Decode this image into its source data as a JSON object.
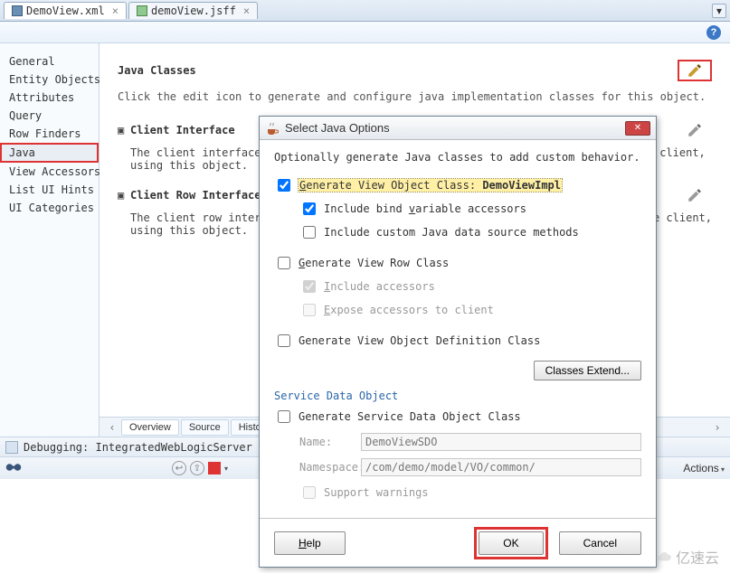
{
  "tabs": [
    {
      "label": "DemoView.xml"
    },
    {
      "label": "demoView.jsff"
    }
  ],
  "sidebar": {
    "items": [
      {
        "label": "General"
      },
      {
        "label": "Entity Objects"
      },
      {
        "label": "Attributes"
      },
      {
        "label": "Query"
      },
      {
        "label": "Row Finders"
      },
      {
        "label": "Java"
      },
      {
        "label": "View Accessors"
      },
      {
        "label": "List UI Hints"
      },
      {
        "label": "UI Categories"
      }
    ]
  },
  "main": {
    "heading": "Java Classes",
    "hint": "Click the edit icon to generate and configure java implementation classes for this object.",
    "sec1_title": "Client Interface",
    "sec1_text": "The client interface contains the view object methods which are available on the client, using this object.",
    "sec2_title": "Client Row Interface",
    "sec2_text": "The client row interface contains the view row methods which are available on the client, using this object."
  },
  "bottomTabs": {
    "t1": "Overview",
    "t2": "Source",
    "t3": "History"
  },
  "log": {
    "title": "Debugging: IntegratedWebLogicServer - Log"
  },
  "actions": "Actions",
  "dialog": {
    "title": "Select Java Options",
    "intro": "Optionally generate Java classes to add custom behavior.",
    "genVO_pre": "Generate View Object Class: ",
    "genVO_cls": "DemoViewImpl",
    "inclBind": "Include bind variable accessors",
    "inclCustom": "Include custom Java data source methods",
    "genRow": "Generate View Row Class",
    "inclAcc": "Include accessors",
    "exposeAcc": "Expose accessors to client",
    "genDef": "Generate View Object Definition Class",
    "clsExt": "Classes Extend...",
    "sdoHead": "Service Data Object",
    "genSDO": "Generate Service Data Object Class",
    "nameLbl": "Name:",
    "nameVal": "DemoViewSDO",
    "nsLbl": "Namespace:",
    "nsVal": "/com/demo/model/VO/common/",
    "suppWarn": "Support warnings",
    "help": "Help",
    "ok": "OK",
    "cancel": "Cancel"
  },
  "watermark": "亿速云"
}
